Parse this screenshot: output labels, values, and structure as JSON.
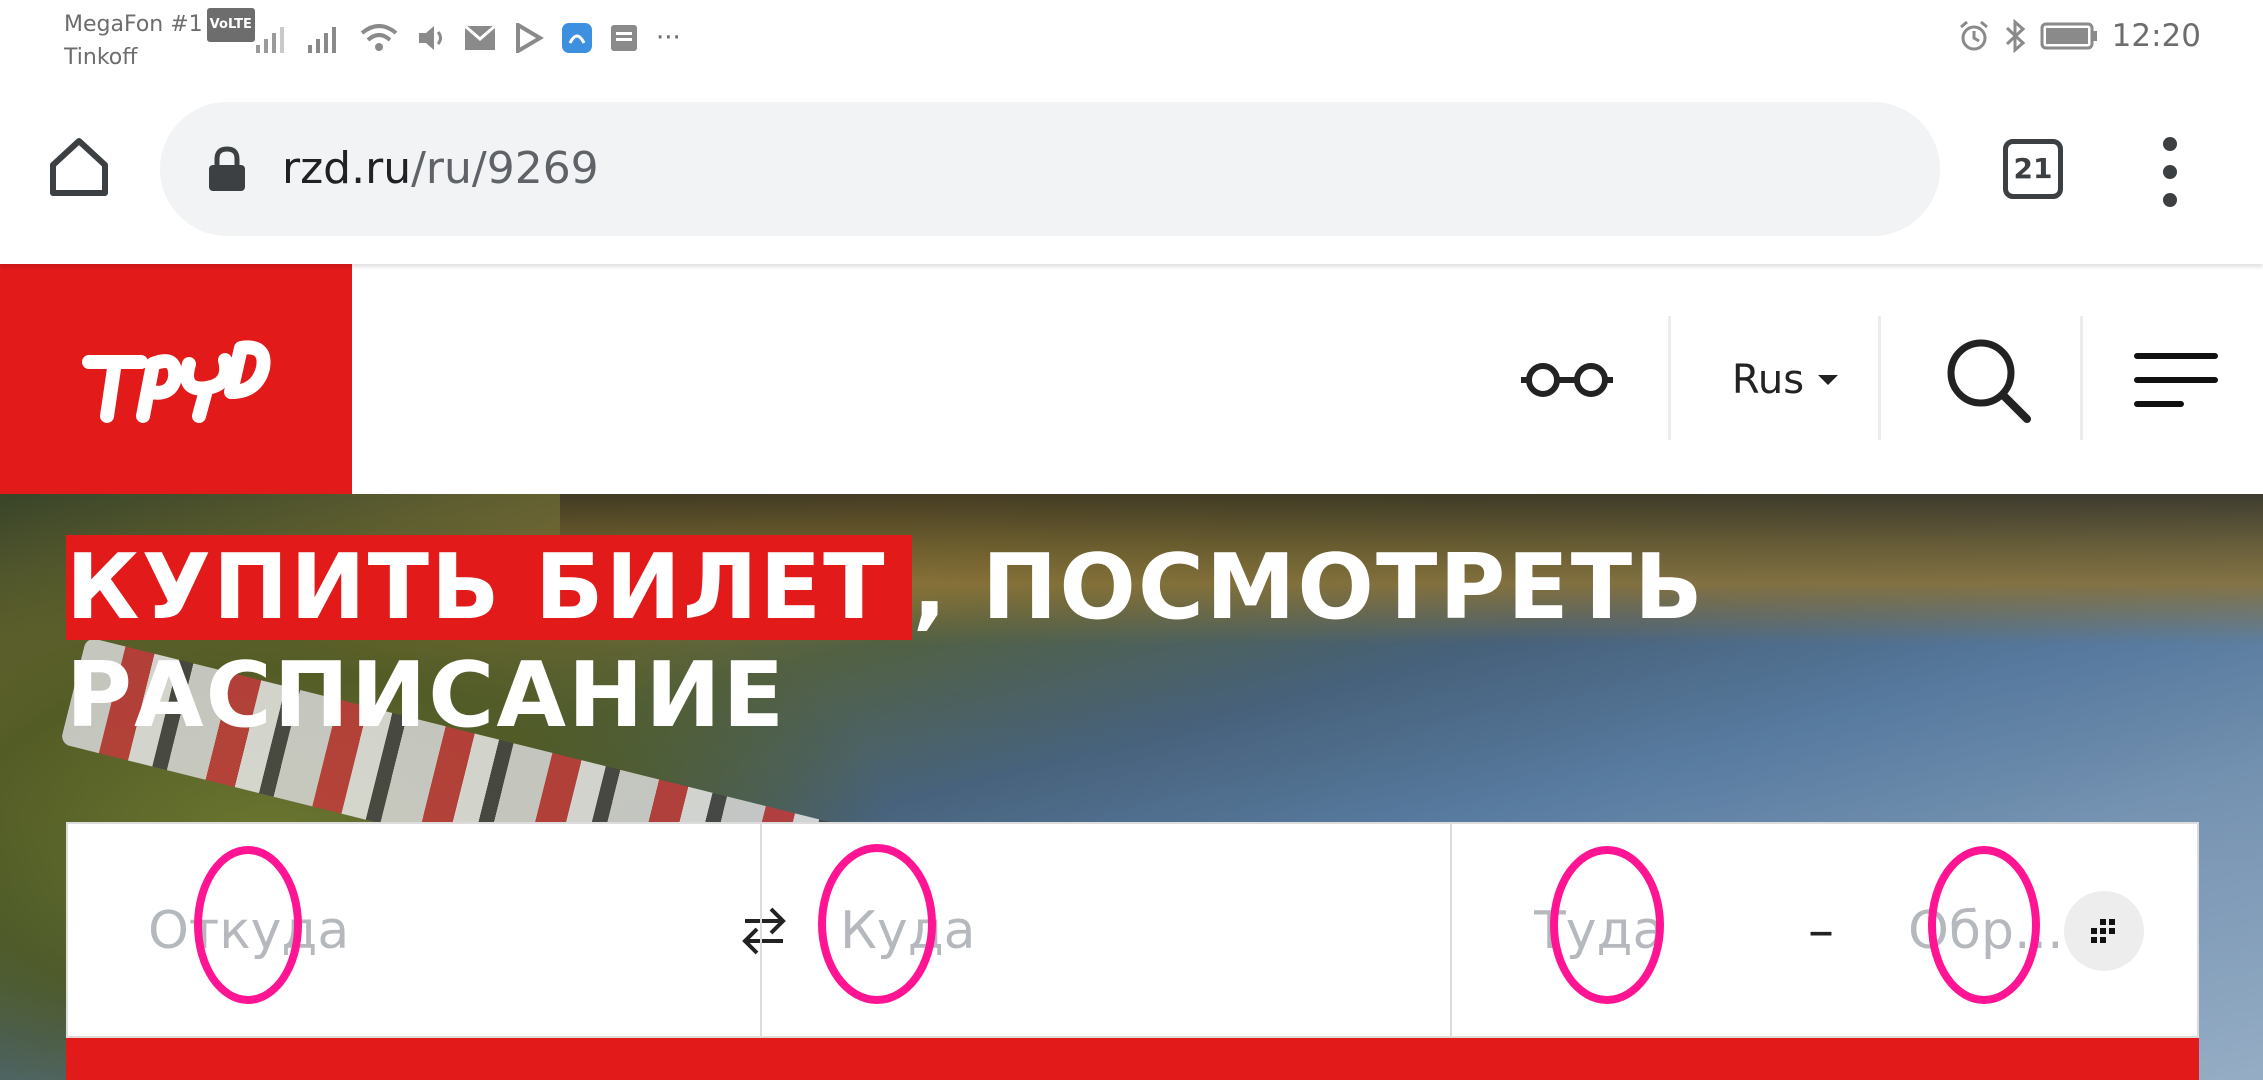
{
  "status_bar": {
    "carrier_1": "MegaFon #1",
    "volte": "VoLTE",
    "carrier_2": "Tinkoff",
    "more": "···",
    "time": "12:20"
  },
  "browser": {
    "url_host": "rzd.ru",
    "url_path": "/ru/9269",
    "tab_count": "21"
  },
  "header": {
    "language": "Rus"
  },
  "hero": {
    "title_highlight": "КУПИТЬ БИЛЕТ",
    "title_rest": ", ПОСМОТРЕТЬ",
    "title_line2": "РАСПИСАНИЕ"
  },
  "search": {
    "from_placeholder": "Откуда",
    "to_placeholder": "Куда",
    "date_there_placeholder": "Туда",
    "date_separator": "–",
    "date_back_placeholder": "Обр..."
  },
  "colors": {
    "brand_red": "#e21a1a",
    "annotation": "#ff1493"
  }
}
